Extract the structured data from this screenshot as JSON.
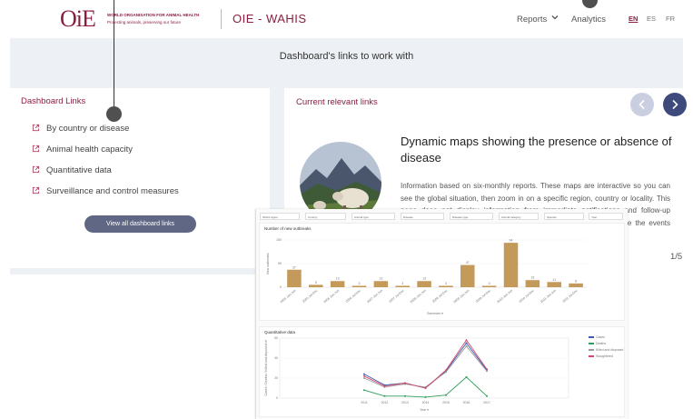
{
  "header": {
    "logo_text": "OiE",
    "org_name": "WORLD ORGANISATION FOR ANIMAL HEALTH",
    "org_tagline": "Protecting animals, preserving our future",
    "app_title": "OIE - WAHIS",
    "nav": {
      "reports": "Reports",
      "analytics": "Analytics"
    },
    "languages": [
      "EN",
      "ES",
      "FR"
    ],
    "active_language": "EN"
  },
  "banner": {
    "title": "Dashboard's links to work with"
  },
  "left_card": {
    "title": "Dashboard Links",
    "links": [
      "By country or disease",
      "Animal health capacity",
      "Quantitative data",
      "Surveillance and control measures"
    ],
    "button": "View all dashboard links"
  },
  "right_card": {
    "title": "Current relevant links",
    "feature_title": "Dynamic maps showing the presence or absence of disease",
    "feature_desc": "Information based on six-monthly reports. These maps are interactive so you can see the global situation, then zoom in on a specific region, country or locality. This page does not display information from immediate notifications and follow-up reports, for information based on immediate notifications please see the events page.",
    "pager": "1/5"
  },
  "colors": {
    "brand": "#8b1e3f",
    "bar": "#c49a5a",
    "nav_button": "#3e4a7c"
  },
  "dashboard": {
    "filters": [
      "World region",
      "Country",
      "Animal type",
      "Disease",
      "Disease type",
      "Animal category",
      "Species",
      "Year"
    ],
    "bar_panel_title": "Number of new outbreaks",
    "bar_axis_label": "New outbreaks",
    "bar_x_label": "Semester",
    "line_panel_title": "Quantitative data",
    "line_y_label": "Cases / Deaths / Killed and disposed of",
    "line_x_label": "Year",
    "line_legend": [
      "Cases",
      "Deaths",
      "Killed and disposed of",
      "Slaughtered"
    ]
  },
  "chart_data": [
    {
      "type": "bar",
      "title": "Number of new outbreaks",
      "categories": [
        "2005 Jan-Jun",
        "2005 Jul-Dec",
        "2006 Jan-Jun",
        "2006 Jul-Dec",
        "2007 Jan-Jun",
        "2007 Jul-Dec",
        "2008 Jan-Jun",
        "2008 Jul-Dec",
        "2009 Jan-Jun",
        "2009 Jul-Dec",
        "2010 Jan-Jun",
        "2010 Jul-Dec",
        "2011 Jan-Jun",
        "2011 Jul-Dec"
      ],
      "values": [
        37,
        5,
        13,
        3,
        13,
        3,
        13,
        3,
        47,
        3,
        94,
        15,
        11,
        8
      ],
      "ylabel": "New outbreaks",
      "xlabel": "Semester",
      "ylim": [
        0,
        100
      ]
    },
    {
      "type": "line",
      "title": "Quantitative data",
      "x": [
        "2011",
        "2012",
        "2013",
        "2014",
        "2015",
        "2016",
        "2017"
      ],
      "series": [
        {
          "name": "Cases",
          "values": [
            24,
            13,
            15,
            10,
            27,
            55,
            28
          ]
        },
        {
          "name": "Deaths",
          "values": [
            8,
            2,
            2,
            1,
            3,
            21,
            2
          ]
        },
        {
          "name": "Killed and disposed of",
          "values": [
            20,
            11,
            14,
            11,
            26,
            52,
            27
          ]
        },
        {
          "name": "Slaughtered",
          "values": [
            22,
            12,
            15,
            10,
            28,
            58,
            29
          ]
        }
      ],
      "ylabel": "Cases / Deaths / Killed and disposed of",
      "xlabel": "Year",
      "ylim": [
        0,
        60
      ]
    }
  ]
}
